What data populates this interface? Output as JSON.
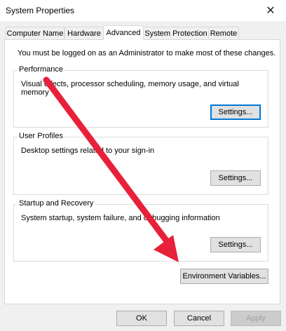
{
  "window": {
    "title": "System Properties",
    "close_glyph": "✕"
  },
  "tabs": [
    {
      "label": "Computer Name"
    },
    {
      "label": "Hardware"
    },
    {
      "label": "Advanced"
    },
    {
      "label": "System Protection"
    },
    {
      "label": "Remote"
    }
  ],
  "active_tab": "Advanced",
  "advanced": {
    "note": "You must be logged on as an Administrator to make most of these changes.",
    "performance": {
      "title": "Performance",
      "description": "Visual effects, processor scheduling, memory usage, and virtual memory",
      "button": "Settings..."
    },
    "user_profiles": {
      "title": "User Profiles",
      "description": "Desktop settings related to your sign-in",
      "button": "Settings..."
    },
    "startup_recovery": {
      "title": "Startup and Recovery",
      "description": "System startup, system failure, and debugging information",
      "button": "Settings..."
    },
    "env_button": "Environment Variables..."
  },
  "footer": {
    "ok": "OK",
    "cancel": "Cancel",
    "apply": "Apply"
  },
  "colors": {
    "annotation_arrow": "#e8213b",
    "focus": "#0078d7"
  }
}
